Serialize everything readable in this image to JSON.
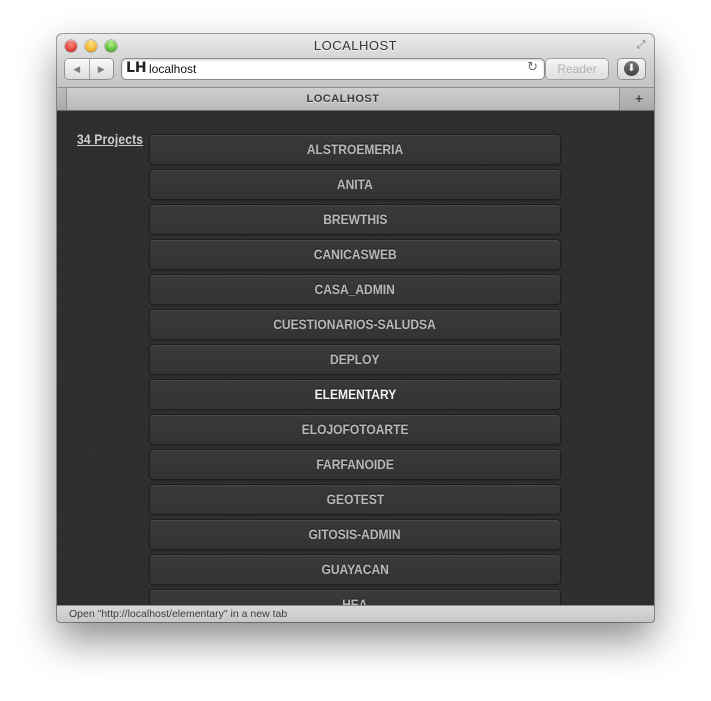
{
  "window": {
    "title": "LOCALHOST",
    "url": "localhost",
    "reader_label": "Reader",
    "tab_title": "LOCALHOST",
    "new_tab_symbol": "+",
    "status_text": "Open \"http://localhost/elementary\" in a new tab"
  },
  "icons": {
    "back": "◀",
    "forward": "▶",
    "reload": "↻",
    "download": "⬇",
    "fullscreen": "⤢",
    "favicon": "LH"
  },
  "content": {
    "project_count_label": "34 Projects",
    "projects": [
      "ALSTROEMERIA",
      "ANITA",
      "BREWTHIS",
      "CANICASWEB",
      "CASA_ADMIN",
      "CUESTIONARIOS-SALUDSA",
      "DEPLOY",
      "ELEMENTARY",
      "ELOJOFOTOARTE",
      "FARFANOIDE",
      "GEOTEST",
      "GITOSIS-ADMIN",
      "GUAYACAN",
      "HEA"
    ],
    "highlighted_project": "ELEMENTARY"
  },
  "colors": {
    "background": "#2e2e2e",
    "item_text": "#b7b7b7",
    "item_text_highlighted": "#f2f2f2"
  }
}
